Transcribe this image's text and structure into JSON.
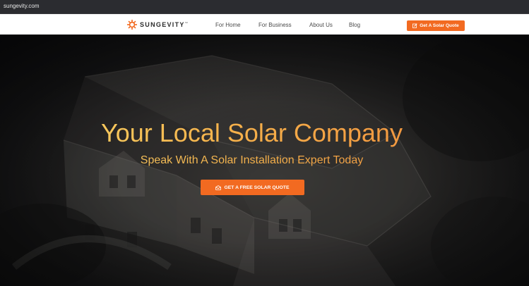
{
  "browser": {
    "url": "sungevity.com"
  },
  "nav": {
    "logo_text": "SUNGEVITY",
    "logo_mark": "™",
    "links": [
      "For Home",
      "For Business",
      "About Us",
      "Blog"
    ],
    "cta_label": "Get A Solar Quote"
  },
  "hero": {
    "headline": "Your Local Solar Company",
    "subheadline": "Speak With A Solar Installation Expert Today",
    "cta_label": "GET A FREE SOLAR QUOTE"
  },
  "icons": {
    "logo": "sun-icon",
    "nav_cta": "edit-icon",
    "hero_cta": "envelope-icon"
  },
  "colors": {
    "accent": "#f26a21",
    "headline_start": "#f7d96a",
    "headline_end": "#f08a3a",
    "hero_background": "#1c1c1e"
  }
}
